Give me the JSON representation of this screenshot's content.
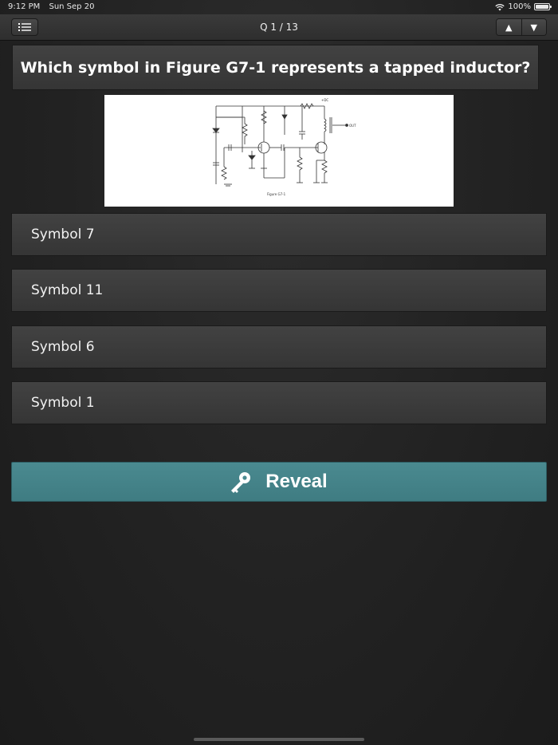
{
  "status_bar": {
    "time": "9:12 PM",
    "date": "Sun Sep 20",
    "battery": "100%"
  },
  "nav": {
    "title": "Q 1 / 13",
    "up_label": "▲",
    "down_label": "▼"
  },
  "question": {
    "text": "Which symbol in Figure G7-1 represents a tapped inductor?"
  },
  "figure": {
    "caption": "Figure G7-1",
    "labels": {
      "vdc": "+DC",
      "out": "OUT"
    }
  },
  "answers": [
    {
      "label": "Symbol 7"
    },
    {
      "label": "Symbol 11"
    },
    {
      "label": "Symbol 6"
    },
    {
      "label": "Symbol 1"
    }
  ],
  "reveal": {
    "label": "Reveal"
  },
  "colors": {
    "reveal_bg": "#468389",
    "panel_bg": "#3c3c3c",
    "background": "#232323"
  }
}
